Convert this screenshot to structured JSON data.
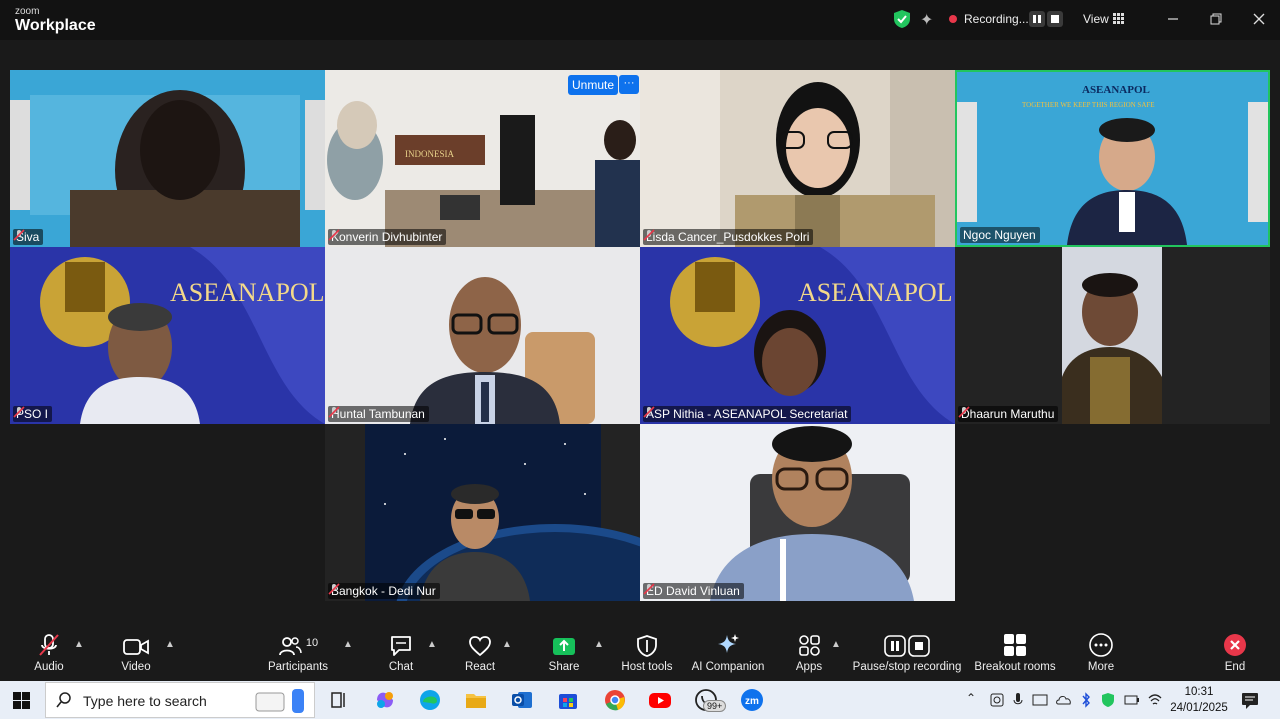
{
  "app": {
    "brand_small": "zoom",
    "brand_big": "Workplace"
  },
  "titlebar": {
    "recording_label": "Recording...",
    "view_label": "View"
  },
  "unmute_label": "Unmute",
  "more_dots": "···",
  "participants": [
    {
      "name": "Siva"
    },
    {
      "name": "Konverin Divhubinter"
    },
    {
      "name": "Lisda Cancer_Pusdokkes Polri"
    },
    {
      "name": "Ngoc Nguyen"
    },
    {
      "name": "PSO I"
    },
    {
      "name": "Huntal Tambunan"
    },
    {
      "name": "ASP Nithia - ASEANAPOL Secretariat"
    },
    {
      "name": "Dhaarun Maruthu"
    },
    {
      "name": "Bangkok - Dedi Nur"
    },
    {
      "name": "ED David Vinluan"
    }
  ],
  "backdrop_text": {
    "aseanapol": "ASEANAPOL",
    "slogan": "TOGETHER WE KEEP THIS REGION SAFE",
    "indonesia": "INDONESIA"
  },
  "toolbar": {
    "audio": "Audio",
    "video": "Video",
    "participants": "Participants",
    "participants_count": "10",
    "chat": "Chat",
    "react": "React",
    "share": "Share",
    "host_tools": "Host tools",
    "ai_companion": "AI Companion",
    "apps": "Apps",
    "pause_stop_recording": "Pause/stop recording",
    "breakout_rooms": "Breakout rooms",
    "more": "More",
    "end": "End"
  },
  "taskbar": {
    "search_placeholder": "Type here to search",
    "whatsapp_badge": "99+",
    "time": "10:31",
    "date": "24/01/2025"
  },
  "colors": {
    "accent": "#0e72ed",
    "active_speaker": "#22c55e",
    "end": "#e8374a",
    "share": "#16c05a"
  }
}
